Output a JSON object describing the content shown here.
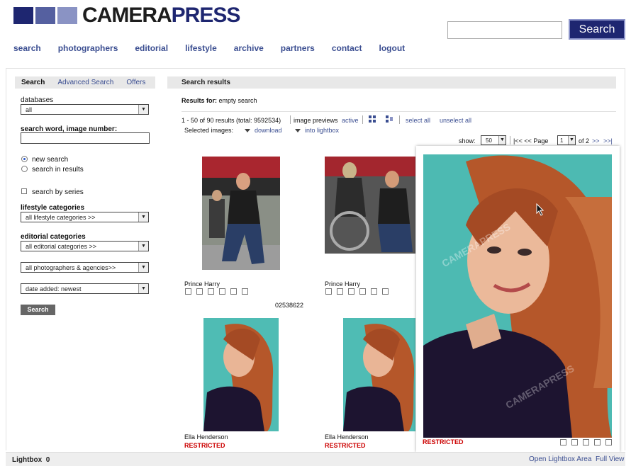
{
  "header": {
    "logo_part1": "CAMERA",
    "logo_part2": "PRESS",
    "search_placeholder": "",
    "search_button": "Search"
  },
  "nav": [
    "search",
    "photographers",
    "editorial",
    "lifestyle",
    "archive",
    "partners",
    "contact",
    "logout"
  ],
  "sidebar": {
    "tabs": [
      "Search",
      "Advanced Search",
      "Offers"
    ],
    "databases_label": "databases",
    "databases_value": "all",
    "search_word_label": "search word, image number:",
    "search_word_value": "",
    "radio_new": "new search",
    "radio_in_results": "search in results",
    "series_label": "search by series",
    "lifestyle_label": "lifestyle categories",
    "lifestyle_value": "all lifestyle categories >>",
    "editorial_label": "editorial categories",
    "editorial_value": "all editorial categories >>",
    "photographers_value": "all photographers & agencies>>",
    "date_value": "date added: newest",
    "search_button": "Search"
  },
  "results": {
    "header": "Search results",
    "results_for_label": "Results for:",
    "results_for_value": "empty search",
    "count_text": "1 - 50 of 90 results (total: 9592534)",
    "image_previews_label": "image previews",
    "image_previews_state": "active",
    "select_all": "select all",
    "unselect_all": "unselect all",
    "selected_images_label": "Selected images:",
    "download": "download",
    "into_lightbox": "into lightbox",
    "show_label": "show:",
    "show_value": "50",
    "pager_first": "|<<",
    "pager_prev": "<<",
    "page_label": "Page",
    "page_value": "1",
    "page_of": "of 2",
    "pager_next": ">>",
    "pager_last": ">>|",
    "items": [
      {
        "caption": "Prince Harry",
        "id": "02538622",
        "restricted": ""
      },
      {
        "caption": "Prince Harry",
        "id": "",
        "restricted": ""
      },
      {
        "caption": "Ella Henderson",
        "id": "",
        "restricted": "RESTRICTED"
      },
      {
        "caption": "Ella Henderson",
        "id": "",
        "restricted": "RESTRICTED"
      }
    ]
  },
  "preview": {
    "restricted": "RESTRICTED",
    "watermark": "CAMERAPRESS"
  },
  "footer": {
    "lightbox_label": "Lightbox",
    "lightbox_count": "0",
    "open_area": "Open Lightbox Area",
    "full_view": "Full View"
  },
  "colors": {
    "brand_blue": "#1e2670",
    "link_blue": "#3b4e91",
    "restricted_red": "#cc0000"
  }
}
